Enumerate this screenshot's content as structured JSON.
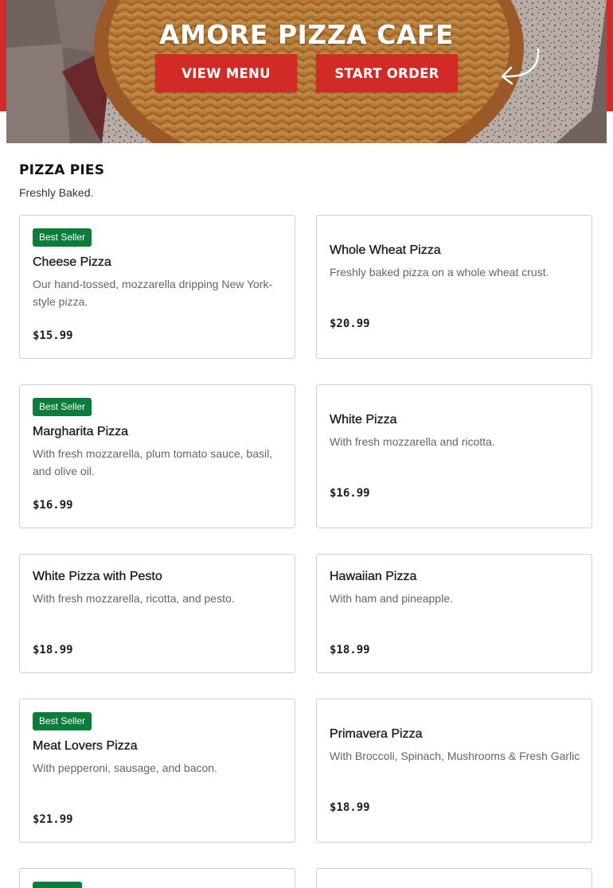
{
  "hero": {
    "title": "AMORE PIZZA CAFE",
    "view_menu_label": "VIEW MENU",
    "start_order_label": "START ORDER"
  },
  "section": {
    "title": "PIZZA PIES",
    "subtitle": "Freshly Baked."
  },
  "badge_label": "Best Seller",
  "items": [
    {
      "name": "Cheese Pizza",
      "description": "Our hand-tossed, mozzarella dripping New York-style pizza.",
      "price": "$15.99",
      "best_seller": true
    },
    {
      "name": "Whole Wheat Pizza",
      "description": "Freshly baked pizza on a whole wheat crust.",
      "price": "$20.99",
      "best_seller": false
    },
    {
      "name": "Margharita Pizza",
      "description": "With fresh mozzarella, plum tomato sauce, basil, and olive oil.",
      "price": "$16.99",
      "best_seller": true
    },
    {
      "name": "White Pizza",
      "description": "With fresh mozzarella and ricotta.",
      "price": "$16.99",
      "best_seller": false
    },
    {
      "name": "White Pizza with Pesto",
      "description": "With fresh mozzarella, ricotta, and pesto.",
      "price": "$18.99",
      "best_seller": false
    },
    {
      "name": "Hawaiian Pizza",
      "description": "With ham and pineapple.",
      "price": "$18.99",
      "best_seller": false
    },
    {
      "name": "Meat Lovers Pizza",
      "description": "With pepperoni, sausage, and bacon.",
      "price": "$21.99",
      "best_seller": true
    },
    {
      "name": "Primavera Pizza",
      "description": "With Broccoli, Spinach, Mushrooms & Fresh Garlic",
      "price": "$18.99",
      "best_seller": false
    }
  ],
  "colors": {
    "brand_red": "#d22b27",
    "badge_green": "#0a7d3b"
  }
}
